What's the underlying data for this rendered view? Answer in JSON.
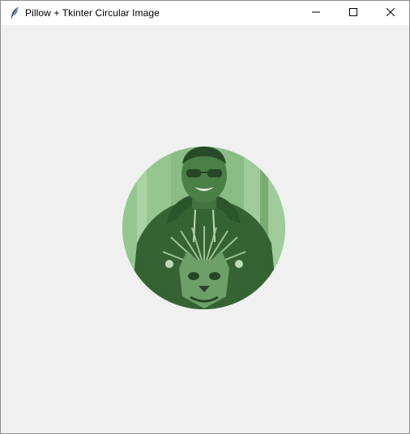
{
  "window": {
    "title": "Pillow + Tkinter Circular Image",
    "icon": "feather-icon"
  },
  "controls": {
    "minimize_icon": "minimize-icon",
    "maximize_icon": "maximize-icon",
    "close_icon": "close-icon"
  },
  "content": {
    "image": "circular-portrait-photo",
    "tint_color": "#6fa86a"
  }
}
